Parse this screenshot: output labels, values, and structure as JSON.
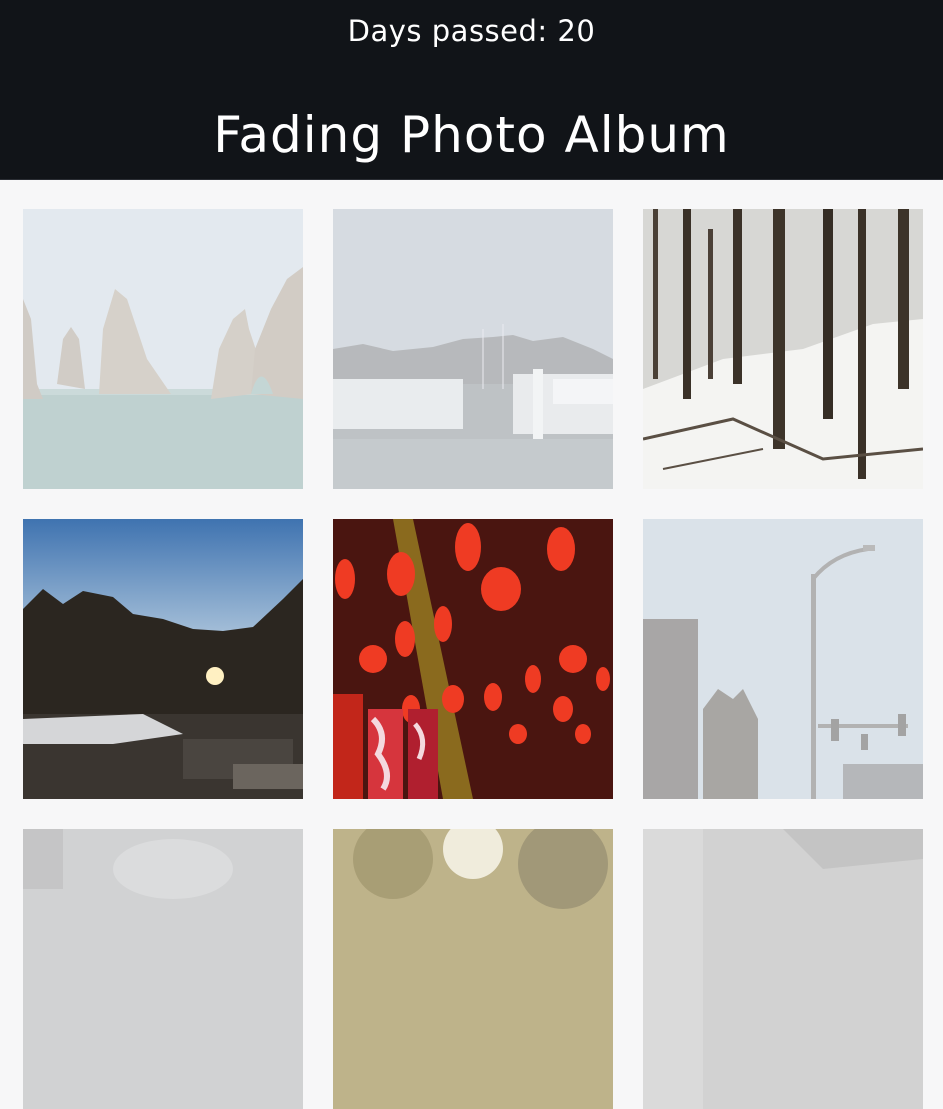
{
  "header": {
    "days_label": "Days passed: 20",
    "title": "Fading Photo Album"
  },
  "colors": {
    "header_bg": "#111418",
    "page_bg": "#f7f7f8"
  },
  "photos": [
    {
      "subject": "sea arches rising from the ocean",
      "fade": 0.6
    },
    {
      "subject": "marina with docked boats",
      "fade": 0.6
    },
    {
      "subject": "snowy forest with bare trees",
      "fade": 0.0
    },
    {
      "subject": "winter park at sunset",
      "fade": 0.0
    },
    {
      "subject": "red chinese lanterns",
      "fade": 0.0
    },
    {
      "subject": "street lamp and traffic lights",
      "fade": 0.55
    },
    {
      "subject": "partially visible photo",
      "fade": 0.6
    },
    {
      "subject": "partially visible tree photo",
      "fade": 0.35
    },
    {
      "subject": "partially visible interior photo",
      "fade": 0.6
    }
  ]
}
